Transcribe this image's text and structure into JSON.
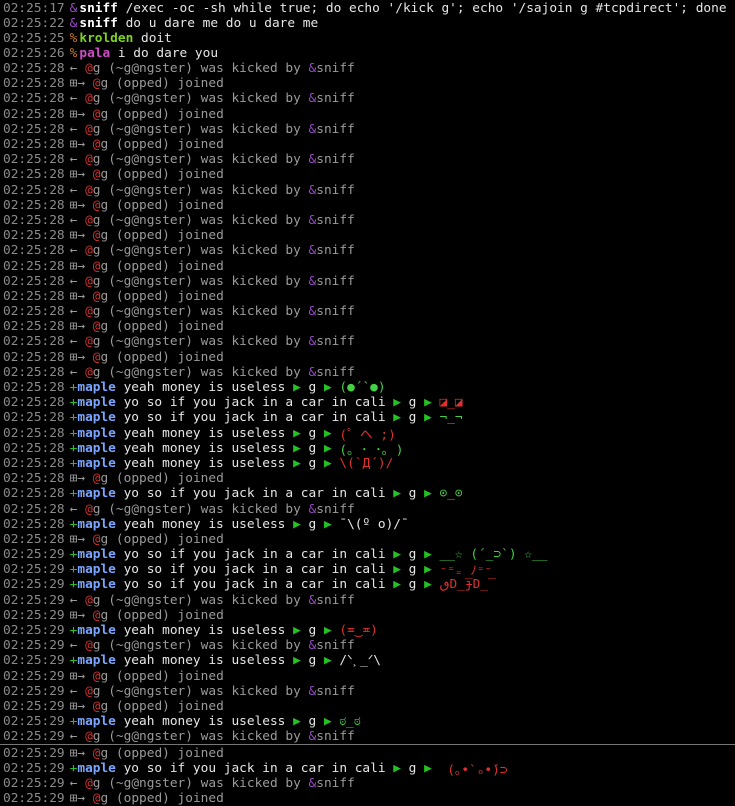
{
  "colors": {
    "timestamp": "#8a8a8a",
    "arrow": "#22c322",
    "op_prefix": "#9b49c9",
    "voice_prefix": "#22c322",
    "halfop_prefix": "#c77b1c",
    "maple": "#7aa6ff",
    "kick_gray": "#9a9a9a",
    "at_red": "#d03030",
    "face_green": "#44d044",
    "face_red": "#e03030"
  },
  "lines": [
    {
      "ts": "02:25:17",
      "pfx": "&",
      "pfxc": "#9b49c9",
      "nick": "sniff",
      "nc": "#ffffff",
      "text": " /exec -oc -sh while true; do echo '/kick g'; echo '/sajoin g #tcpdirect'; done",
      "h": 16
    },
    {
      "ts": "02:25:22",
      "pfx": "&",
      "pfxc": "#9b49c9",
      "nick": "sniff",
      "nc": "#ffffff",
      "text": " do u dare me do u dare me",
      "h": 15
    },
    {
      "ts": "02:25:25",
      "pfx": "%",
      "pfxc": "#c77b1c",
      "nick": "krolden",
      "nc": "#7ed321",
      "text": " doit",
      "h": 15
    },
    {
      "ts": "02:25:26",
      "pfx": "%",
      "pfxc": "#c77b1c",
      "nick": "pala",
      "nc": "#d04cc8",
      "text": " i do dare you",
      "h": 15
    },
    {
      "type": "kick",
      "ts": "02:25:28"
    },
    {
      "type": "join",
      "ts": "02:25:28"
    },
    {
      "type": "kick",
      "ts": "02:25:28"
    },
    {
      "type": "join",
      "ts": "02:25:28"
    },
    {
      "type": "kick",
      "ts": "02:25:28"
    },
    {
      "type": "join",
      "ts": "02:25:28"
    },
    {
      "type": "kick",
      "ts": "02:25:28"
    },
    {
      "type": "join",
      "ts": "02:25:28"
    },
    {
      "type": "kick",
      "ts": "02:25:28"
    },
    {
      "type": "join",
      "ts": "02:25:28"
    },
    {
      "type": "kick",
      "ts": "02:25:28"
    },
    {
      "type": "join",
      "ts": "02:25:28"
    },
    {
      "type": "kick",
      "ts": "02:25:28"
    },
    {
      "type": "join",
      "ts": "02:25:28"
    },
    {
      "type": "kick",
      "ts": "02:25:28"
    },
    {
      "type": "join",
      "ts": "02:25:28"
    },
    {
      "type": "kick",
      "ts": "02:25:28"
    },
    {
      "type": "join",
      "ts": "02:25:28"
    },
    {
      "type": "kick",
      "ts": "02:25:28"
    },
    {
      "type": "join",
      "ts": "02:25:28"
    },
    {
      "type": "kick",
      "ts": "02:25:28"
    },
    {
      "type": "msg",
      "ts": "02:25:28",
      "text": " yeah money is useless ",
      "face": "(●´`●)",
      "fc": "#44d044"
    },
    {
      "type": "msg",
      "ts": "02:25:28",
      "text": " yo so if you jack in a car in cali ",
      "face": "◪_◪",
      "fc": "#e03030"
    },
    {
      "type": "msg",
      "ts": "02:25:28",
      "text": " yo so if you jack in a car in cali ",
      "face": "¬_¬",
      "fc": "#44d044"
    },
    {
      "type": "msg",
      "ts": "02:25:28",
      "text": " yeah money is useless ",
      "face": "(゜ヘ ;)",
      "fc": "#e03030"
    },
    {
      "type": "msg",
      "ts": "02:25:28",
      "text": " yeah money is useless ",
      "face": "(｡ ･_･｡ )",
      "fc": "#44d044"
    },
    {
      "type": "msg",
      "ts": "02:25:28",
      "text": " yeah money is useless ",
      "face": "\\(`Д´)/",
      "fc": "#e03030"
    },
    {
      "type": "join",
      "ts": "02:25:28"
    },
    {
      "type": "msg",
      "ts": "02:25:28",
      "text": " yo so if you jack in a car in cali ",
      "face": "⊙_⊙",
      "fc": "#44d044"
    },
    {
      "type": "kick",
      "ts": "02:25:28"
    },
    {
      "type": "msg",
      "ts": "02:25:28",
      "text": " yeah money is useless ",
      "face": "¯\\(º o)/¯",
      "fc": "#e6e6e6"
    },
    {
      "type": "join",
      "ts": "02:25:28"
    },
    {
      "type": "msg",
      "ts": "02:25:29",
      "text": " yo so if you jack in a car in cali ",
      "face": "__☆ (´_⊃`) ☆__",
      "fc": "#44d044"
    },
    {
      "type": "msg",
      "ts": "02:25:29",
      "text": " yo so if you jack in a car in cali ",
      "face": "⁻⁼₌_ﾉ⁼⁻",
      "fc": "#e03030"
    },
    {
      "type": "msg",
      "ts": "02:25:29",
      "text": " yo so if you jack in a car in cali ",
      "face": "ٯD̲̅ɟD̲̅",
      "fc": "#e03030"
    },
    {
      "type": "kick",
      "ts": "02:25:29"
    },
    {
      "type": "join",
      "ts": "02:25:29"
    },
    {
      "type": "msg",
      "ts": "02:25:29",
      "text": " yeah money is useless ",
      "face": "(≖‿≖)",
      "fc": "#e03030"
    },
    {
      "type": "kick",
      "ts": "02:25:29"
    },
    {
      "type": "msg",
      "ts": "02:25:29",
      "text": " yeah money is useless ",
      "face": "/ᐠ˲_ᐟ\\",
      "fc": "#e6e6e6"
    },
    {
      "type": "join",
      "ts": "02:25:29"
    },
    {
      "type": "kick",
      "ts": "02:25:29"
    },
    {
      "type": "join",
      "ts": "02:25:29"
    },
    {
      "type": "msg",
      "ts": "02:25:29",
      "text": " yeah money is useless ",
      "face": "ಠ_ಠ",
      "fc": "#44d044"
    },
    {
      "type": "kick",
      "ts": "02:25:29",
      "sep": true
    },
    {
      "type": "join",
      "ts": "02:25:29"
    },
    {
      "type": "msg",
      "ts": "02:25:29",
      "text": " yo so if you jack in a car in cali ",
      "face": " (｡•̀ ₒ•́)⊃",
      "fc": "#e03030"
    },
    {
      "type": "kick",
      "ts": "02:25:29"
    },
    {
      "type": "join",
      "ts": "02:25:29"
    }
  ],
  "kick": {
    "arrow": "← ",
    "at": "@",
    "g": "g ",
    "host": "(~g@ngster) was kicked by ",
    "amp": "&",
    "by": "sniff"
  },
  "join": {
    "box": "⊞",
    "arrow": "→ ",
    "at": "@",
    "g": "g ",
    "rest": "(opped) joined"
  },
  "msg": {
    "plus": "+",
    "nick": "maple",
    "tri": "▶",
    "g": " g "
  }
}
